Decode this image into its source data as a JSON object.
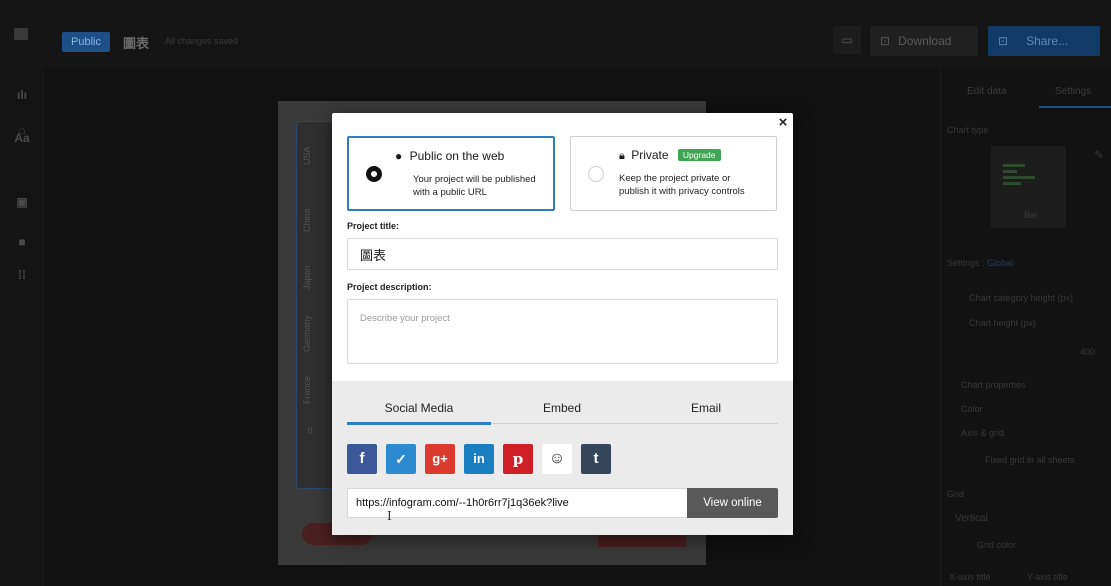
{
  "topbar": {
    "visibility_pill": "Public",
    "project_name": "圖表",
    "saved_status": "All changes saved",
    "download_label": "Download",
    "share_label": "Share..."
  },
  "leftbar": {
    "items": [
      {
        "icon": "bar-chart-icon",
        "glyph": "ılı"
      },
      {
        "icon": "map-icon",
        "glyph": "⌂"
      },
      {
        "icon": "text-icon",
        "glyph": "Aa"
      },
      {
        "icon": "image-icon",
        "glyph": "▣"
      },
      {
        "icon": "video-icon",
        "glyph": "■"
      },
      {
        "icon": "grid-icon",
        "glyph": "⁞⁞"
      }
    ]
  },
  "canvas": {
    "row_labels": [
      "USA",
      "China",
      "Japan",
      "Germany",
      "France"
    ],
    "axis_zero": "0"
  },
  "right_panel": {
    "tab_edit": "Edit data",
    "tab_settings": "Settings",
    "chart_type_label": "Chart type",
    "chart_type_value": "Bar",
    "settings_label": "Settings :",
    "settings_scope": "Global",
    "opt_category_height": "Chart category height (px)",
    "opt_chart_height": "Chart height (px)",
    "height_value": "400",
    "chart_properties": "Chart properties",
    "color": "Color",
    "axis_grid": "Axis & grid",
    "fixed_grid": "Fixed grid in all sheets",
    "grid_label": "Grid",
    "grid_value": "Vertical",
    "grid_color": "Grid color",
    "x_axis_title": "X-axis title",
    "y_axis_title": "Y-axis title"
  },
  "modal": {
    "close_glyph": "×",
    "public": {
      "title": "Public on the web",
      "desc_line1": "Your project will be published",
      "desc_line2": "with a public URL",
      "selected": true
    },
    "private": {
      "title": "Private",
      "badge": "Upgrade",
      "desc_line1": "Keep the project private or",
      "desc_line2": "publish it with privacy controls",
      "selected": false
    },
    "project_title_label": "Project title:",
    "project_title_value": "圖表",
    "project_description_label": "Project description:",
    "project_description_placeholder": "Describe your project",
    "share_tabs": [
      "Social Media",
      "Embed",
      "Email"
    ],
    "active_tab": "Social Media",
    "social_buttons": [
      {
        "name": "facebook",
        "glyph": "f",
        "color": "#3b5998"
      },
      {
        "name": "twitter",
        "glyph": "🐦",
        "color": "#2c8ad1"
      },
      {
        "name": "google-plus",
        "glyph": "g+",
        "color": "#db3b2f"
      },
      {
        "name": "linkedin",
        "glyph": "in",
        "color": "#1a7fc0"
      },
      {
        "name": "pinterest",
        "glyph": "p",
        "color": "#cf2027"
      },
      {
        "name": "reddit",
        "glyph": "👽",
        "color": "#ffffff"
      },
      {
        "name": "tumblr",
        "glyph": "t",
        "color": "#35465c"
      }
    ],
    "share_url": "https://infogram.com/--1h0r6rr7j1q36ek?live",
    "view_online_label": "View online"
  },
  "colors": {
    "accent": "#2d7dc2",
    "upgrade_green": "#3fa553",
    "view_online_bg": "#595959"
  }
}
